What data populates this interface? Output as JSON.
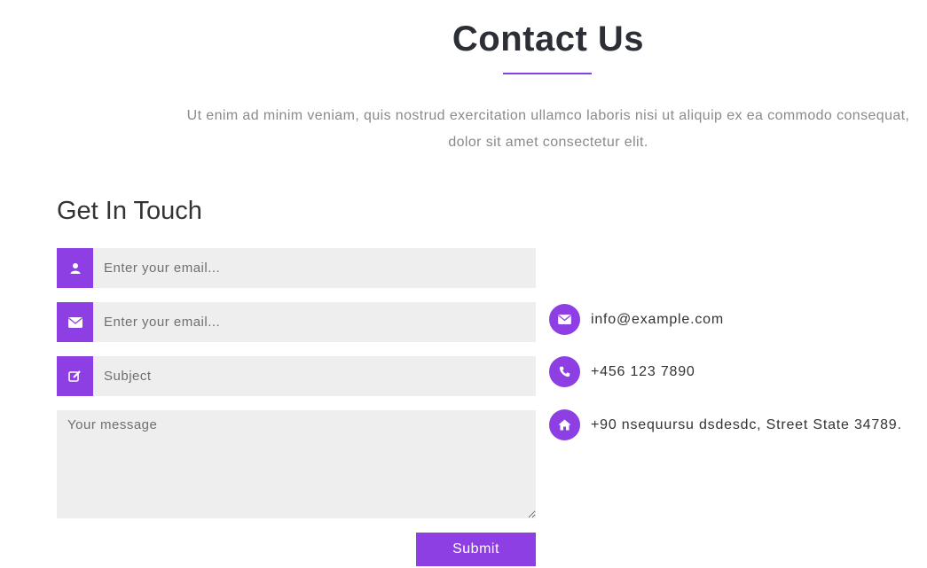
{
  "header": {
    "title": "Contact Us",
    "intro": "Ut enim ad minim veniam, quis nostrud exercitation ullamco laboris nisi ut aliquip ex ea commodo consequat, dolor sit amet consectetur elit."
  },
  "form": {
    "heading": "Get In Touch",
    "name_placeholder": "Enter your email...",
    "email_placeholder": "Enter your email...",
    "subject_placeholder": "Subject",
    "message_placeholder": "Your message",
    "submit_label": "Submit"
  },
  "contact": {
    "email": "info@example.com",
    "phone": "+456 123 7890",
    "address": "+90 nsequursu dsdesdc, Street State 34789."
  },
  "icons": {
    "name": "user-icon",
    "email": "envelope-icon",
    "subject": "edit-icon",
    "phone": "phone-icon",
    "address": "home-icon"
  },
  "colors": {
    "accent": "#8e3fe4",
    "field_bg": "#eeeeee",
    "intro_text": "#8a8a8a"
  }
}
